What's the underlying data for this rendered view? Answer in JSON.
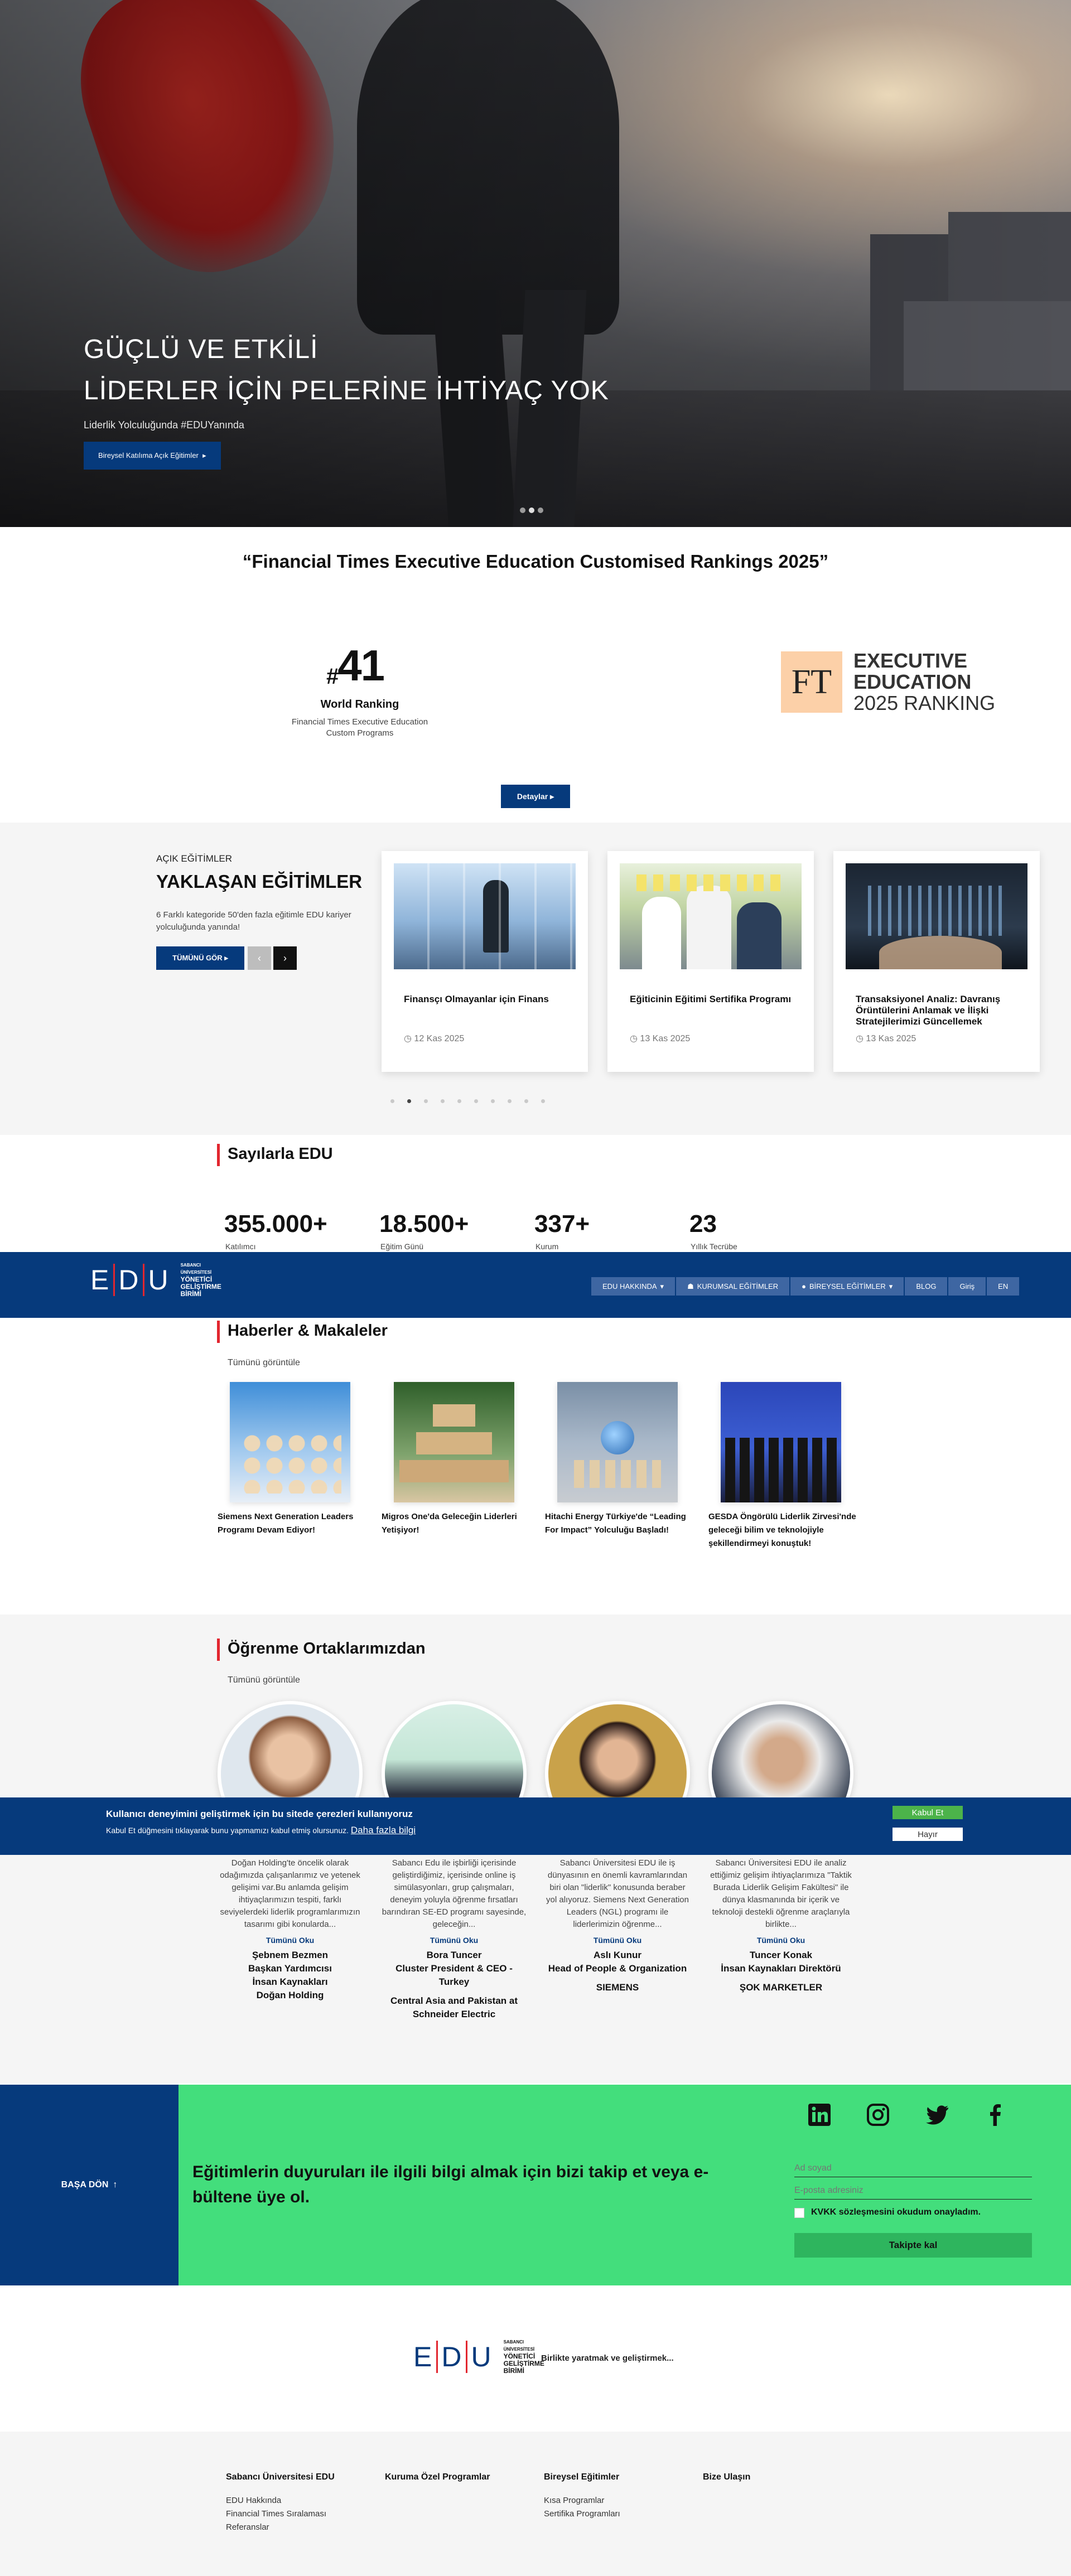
{
  "hero": {
    "title_line1": "GÜÇLÜ VE ETKİLİ",
    "title_line2": "LİDERLER İÇİN PELERİNE İHTİYAÇ YOK",
    "subtitle": "Liderlik Yolculuğunda #EDUYanında",
    "button": "Bireysel Katılıma Açık Eğitimler",
    "slide_count": 3,
    "active_slide": 2
  },
  "ft": {
    "heading": "“Financial Times Executive Education Customised Rankings 2025”",
    "rank_hash": "#",
    "rank": "41",
    "rank_label": "World Ranking",
    "rank_desc": "Financial Times Executive Education Custom Programs",
    "logo_letters": "FT",
    "logo_line1": "EXECUTIVE",
    "logo_line2": "EDUCATION",
    "logo_line3": "2025 RANKING",
    "button": "Detaylar"
  },
  "courses": {
    "label": "AÇIK EĞİTİMLER",
    "title": "YAKLAŞAN EĞİTİMLER",
    "desc": "6 Farklı kategoride 50'den fazla eğitimle EDU kariyer yolculuğunda yanında!",
    "all_button": "TÜMÜNÜ GÖR",
    "items": [
      {
        "title": "Finansçı Olmayanlar için Finans",
        "date": "12 Kas 2025"
      },
      {
        "title": "Eğiticinin Eğitimi Sertifika Programı",
        "date": "13 Kas 2025"
      },
      {
        "title": "Transaksiyonel Analiz: Davranış Örüntülerini Anlamak ve İlişki Stratejilerimizi Güncellemek",
        "date": "13 Kas 2025"
      }
    ],
    "dots": 10,
    "active_dot": 2
  },
  "stats": {
    "title": "Sayılarla EDU",
    "items": [
      {
        "value": "355.000+",
        "label": "Katılımcı"
      },
      {
        "value": "18.500+",
        "label": "Eğitim Günü"
      },
      {
        "value": "337+",
        "label": "Kurum"
      },
      {
        "value": "23",
        "label": "Yıllık Tecrübe"
      }
    ]
  },
  "nav": {
    "logo_letters": [
      "E",
      "D",
      "U"
    ],
    "logo_line1": "SABANCI",
    "logo_line2": "ÜNİVERSİTESİ",
    "logo_line3": "YÖNETİCİ",
    "logo_line4": "GELİŞTİRME",
    "logo_line5": "BİRİMİ",
    "items": [
      "EDU HAKKINDA",
      "KURUMSAL EĞİTİMLER",
      "BİREYSEL EĞİTİMLER",
      "BLOG",
      "Giriş",
      "EN"
    ]
  },
  "news": {
    "title": "Haberler & Makaleler",
    "all": "Tümünü görüntüle",
    "items": [
      "Siemens Next Generation Leaders Programı Devam Ediyor!",
      "Migros One'da Geleceğin Liderleri Yetişiyor!",
      "Hitachi Energy Türkiye'de “Leading For Impact” Yolculuğu Başladı!",
      "GESDA Öngörülü Liderlik Zirvesi'nde geleceği bilim ve teknolojiyle şekillendirmeyi konuştuk!"
    ]
  },
  "partners": {
    "title": "Öğrenme Ortaklarımızdan",
    "all": "Tümünü görüntüle",
    "more": "Tümünü Oku",
    "items": [
      {
        "text": "Doğan Holding'te öncelik olarak odağımızda çalışanlarımız ve yetenek gelişimi var.Bu anlamda gelişim ihtiyaçlarımızın tespiti, farklı seviyelerdeki liderlik programlarımızın tasarımı gibi konularda...",
        "name": "Şebnem Bezmen\nBaşkan Yardımcısı\nİnsan Kaynakları\nDoğan Holding",
        "company": ""
      },
      {
        "text": "Sabancı Edu ile işbirliği içerisinde geliştirdiğimiz, içerisinde online iş simülasyonları, grup çalışmaları, deneyim yoluyla öğrenme fırsatları barındıran SE-ED programı sayesinde, geleceğin...",
        "name": "Bora Tuncer\nCluster President & CEO - Turkey",
        "company": "Central Asia and Pakistan at Schneider Electric"
      },
      {
        "text": "Sabancı Üniversitesi EDU ile iş dünyasının en önemli kavramlarından biri olan \"liderlik\" konusunda beraber yol alıyoruz. Siemens Next Generation Leaders (NGL) programı ile liderlerimizin öğrenme...",
        "name": "Aslı Kunur\nHead of People & Organization",
        "company": "SIEMENS"
      },
      {
        "text": "Sabancı Üniversitesi EDU ile analiz ettiğimiz gelişim ihtiyaçlarımıza \"Taktik Burada Liderlik Gelişim Fakültesi\" ile dünya klasmanında bir içerik ve teknoloji destekli öğrenme araçlarıyla birlikte...",
        "name": "Tuncer Konak\nİnsan Kaynakları Direktörü",
        "company": "ŞOK MARKETLER"
      }
    ]
  },
  "cookie": {
    "title": "Kullanıcı deneyimini geliştirmek için bu sitede çerezleri kullanıyoruz",
    "text": "Kabul Et düğmesini tıklayarak bunu yapmamızı kabul etmiş olursunuz.",
    "link": "Daha fazla bilgi",
    "accept": "Kabul Et",
    "reject": "Hayır"
  },
  "newsletter": {
    "back_top": "BAŞA DÖN",
    "text": "Eğitimlerin duyuruları ile ilgili bilgi almak için bizi takip et veya e-bültene üye ol.",
    "name_placeholder": "Ad soyad",
    "email_placeholder": "E-posta adresiniz",
    "kvkk": "KVKK sözleşmesini okudum onayladım.",
    "button": "Takipte kal",
    "social": [
      "linkedin-icon",
      "instagram-icon",
      "twitter-icon",
      "facebook-icon"
    ]
  },
  "footer": {
    "slogan": "Birlikte yaratmak ve geliştirmek...",
    "cols": [
      {
        "title": "Sabancı Üniversitesi EDU",
        "links": [
          "EDU Hakkında",
          "Financial Times Sıralaması",
          "Referanslar"
        ]
      },
      {
        "title": "Kuruma Özel Programlar",
        "links": []
      },
      {
        "title": "Bireysel Eğitimler",
        "links": [
          "Kısa Programlar",
          "Sertifika Programları"
        ]
      },
      {
        "title": "Bize Ulaşın",
        "links": []
      }
    ]
  },
  "colors": {
    "primary": "#063a7c",
    "accent": "#e2262f",
    "green": "#43de7c"
  }
}
